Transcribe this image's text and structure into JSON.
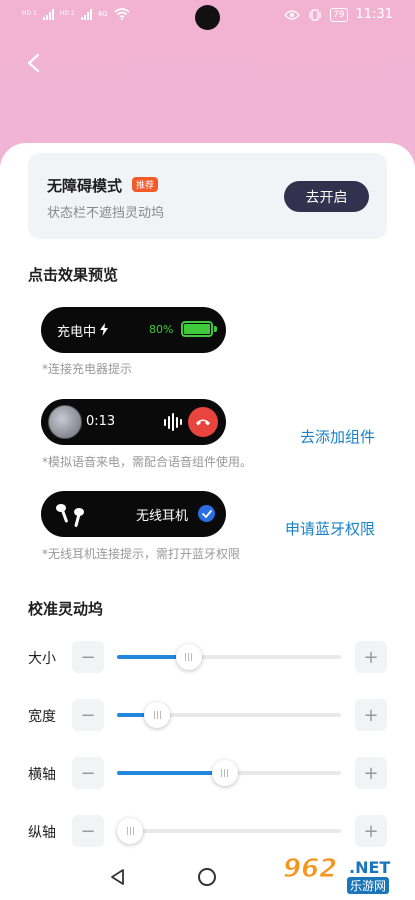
{
  "status_bar": {
    "sim1_tag": "HD 1",
    "sim2_tag": "HD 2",
    "network_type": "4G",
    "battery": "79",
    "time": "11:31"
  },
  "colors": {
    "header_pink": "#f2b3d3",
    "accent_blue": "#2387dd",
    "action_blue": "#1a82c7",
    "badge_orange": "#f25a2b",
    "button_dark": "#33324e",
    "charging_green": "#3fca3c"
  },
  "accessibility_card": {
    "title": "无障碍模式",
    "badge": "推荐",
    "subtitle": "状态栏不遮挡灵动坞",
    "button": "去开启"
  },
  "preview": {
    "title": "点击效果预览",
    "charging": {
      "label": "充电中",
      "percent": "80%",
      "hint": "*连接充电器提示",
      "icon": "lightning-icon"
    },
    "call": {
      "time": "0:13",
      "hint": "*模拟语音来电，需配合语音组件使用。",
      "action": "去添加组件",
      "icon": "hangup-icon"
    },
    "earphone": {
      "label": "无线耳机",
      "hint": "*无线耳机连接提示，需打开蓝牙权限",
      "action": "申请蓝牙权限",
      "icon": "earbuds-icon"
    }
  },
  "calibration": {
    "title": "校准灵动坞",
    "rows": [
      {
        "label": "大小",
        "value_fraction": 0.32
      },
      {
        "label": "宽度",
        "value_fraction": 0.18
      },
      {
        "label": "横轴",
        "value_fraction": 0.48
      },
      {
        "label": "纵轴",
        "value_fraction": 0.04
      }
    ],
    "minus_symbol": "−",
    "plus_symbol": "+"
  },
  "watermark": {
    "number": "962",
    "suffix": ".NET",
    "site_name": "乐游网"
  }
}
